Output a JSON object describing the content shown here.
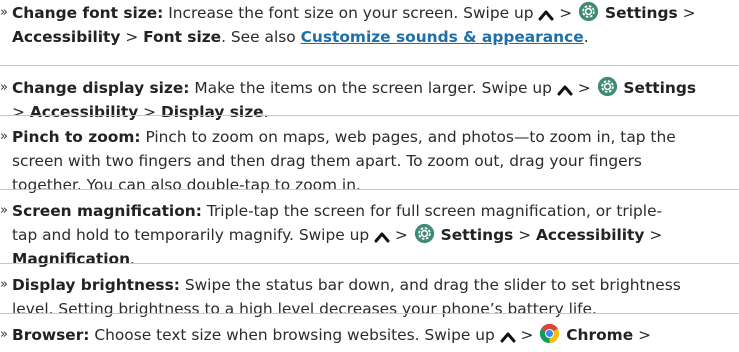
{
  "bullet": "»",
  "sep": ">",
  "items": [
    {
      "title": "Change font size:",
      "text1": "Increase the font size on your screen. Swipe up",
      "settings": "Settings",
      "path1": "Accessibility",
      "path2": "Font size",
      "see_also": ". See also",
      "link": "Customize sounds & appearance",
      "end": "."
    },
    {
      "title": "Change display size:",
      "text1": "Make the items on the screen larger. Swipe up",
      "settings": "Settings",
      "path1": "Accessibility",
      "path2": "Display size",
      "end": "."
    },
    {
      "title": "Pinch to zoom:",
      "text1": "Pinch to zoom on maps, web pages, and photos—to zoom in, tap the",
      "text2": "screen with two fingers and then drag them apart. To zoom out, drag your fingers",
      "text3": "together. You can also double-tap to zoom in."
    },
    {
      "title": "Screen magnification:",
      "text1": "Triple-tap the screen for full screen magnification, or triple-",
      "text2": "tap and hold to temporarily magnify. Swipe up",
      "settings": "Settings",
      "path1": "Accessibility",
      "path2": "Magnification",
      "end": "."
    },
    {
      "title": "Display brightness:",
      "text1": "Swipe the status bar down, and drag the slider to set brightness",
      "text2": "level. Setting brightness to a high level decreases your phone’s battery life."
    },
    {
      "title": "Browser:",
      "text1": "Choose text size when browsing websites. Swipe up",
      "chrome": "Chrome"
    }
  ],
  "icons": {
    "swipe_up": "chevron-up-icon",
    "settings": "gear-icon",
    "chrome": "chrome-icon"
  },
  "colors": {
    "text": "#2b2b2b",
    "link": "#1f6fa8",
    "divider": "#c8c8c8"
  }
}
